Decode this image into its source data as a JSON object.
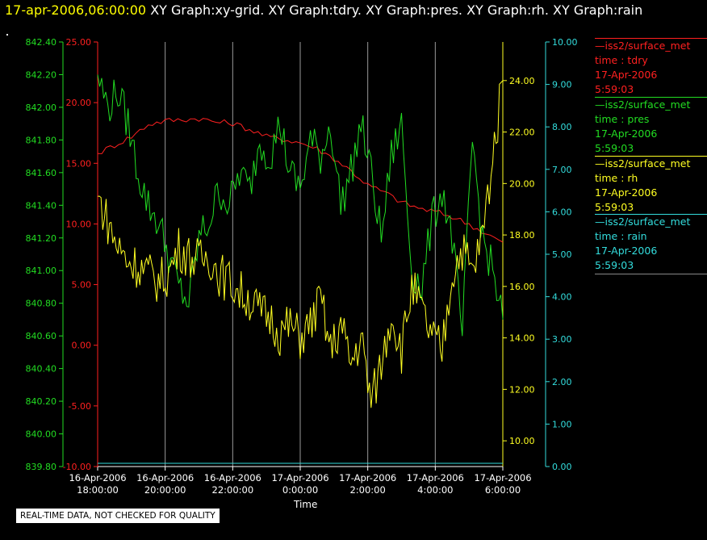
{
  "header": {
    "date": "17-apr-2006,06:00:00",
    "graphs": "XY Graph:xy-grid.  XY Graph:tdry.  XY Graph:pres.  XY Graph:rh.  XY Graph:rain"
  },
  "disclaimer": "REAL-TIME DATA, NOT CHECKED FOR QUALITY",
  "legend": [
    {
      "source": "—iss2/surface_met",
      "field": "time : tdry",
      "date": "17-Apr-2006",
      "time": "5:59:03",
      "color": "#ff2020"
    },
    {
      "source": "—iss2/surface_met",
      "field": "time : pres",
      "date": "17-Apr-2006",
      "time": "5:59:03",
      "color": "#22dd22"
    },
    {
      "source": "—iss2/surface_met",
      "field": "time : rh",
      "date": "17-Apr-2006",
      "time": "5:59:03",
      "color": "#ffff22"
    },
    {
      "source": "—iss2/surface_met",
      "field": "time : rain",
      "date": "17-Apr-2006",
      "time": "5:59:03",
      "color": "#33dddd"
    }
  ],
  "chart_data": {
    "type": "line",
    "xlabel": "Time",
    "x_ticks": [
      {
        "hour": 0,
        "line1": "16-Apr-2006",
        "line2": "18:00:00"
      },
      {
        "hour": 2,
        "line1": "16-Apr-2006",
        "line2": "20:00:00"
      },
      {
        "hour": 4,
        "line1": "16-Apr-2006",
        "line2": "22:00:00"
      },
      {
        "hour": 6,
        "line1": "17-Apr-2006",
        "line2": "0:00:00"
      },
      {
        "hour": 8,
        "line1": "17-Apr-2006",
        "line2": "2:00:00"
      },
      {
        "hour": 10,
        "line1": "17-Apr-2006",
        "line2": "4:00:00"
      },
      {
        "hour": 12,
        "line1": "17-Apr-2006",
        "line2": "6:00:00"
      }
    ],
    "xlim": [
      0,
      12
    ],
    "grid": true,
    "axes": [
      {
        "name": "pres",
        "color": "#22dd22",
        "ylim": [
          839.8,
          842.4
        ],
        "ticks": [
          "839.80",
          "840.00",
          "840.20",
          "840.40",
          "840.60",
          "840.80",
          "841.00",
          "841.20",
          "841.40",
          "841.60",
          "841.80",
          "842.00",
          "842.20",
          "842.40"
        ]
      },
      {
        "name": "tdry",
        "color": "#ff2020",
        "ylim": [
          -10,
          25
        ],
        "ticks": [
          "-10.00",
          "-5.00",
          "0.00",
          "5.00",
          "10.00",
          "15.00",
          "20.00",
          "25.00"
        ]
      },
      {
        "name": "rh",
        "color": "#ffff22",
        "ylim": [
          9,
          25.5
        ],
        "ticks": [
          "10.00",
          "12.00",
          "14.00",
          "16.00",
          "18.00",
          "20.00",
          "22.00",
          "24.00"
        ]
      },
      {
        "name": "rain",
        "color": "#33dddd",
        "ylim": [
          0,
          10
        ],
        "ticks": [
          "0.00",
          "1.00",
          "2.00",
          "3.00",
          "4.00",
          "5.00",
          "6.00",
          "7.00",
          "8.00",
          "9.00",
          "10.00"
        ]
      }
    ],
    "series": [
      {
        "name": "iss2/surface_met time : tdry",
        "axis": "tdry",
        "color": "#ff2020",
        "x": [
          0,
          0.5,
          1,
          1.5,
          2,
          2.5,
          3,
          3.5,
          4,
          4.5,
          5,
          5.5,
          6,
          6.5,
          7,
          7.5,
          8,
          8.5,
          9,
          9.5,
          10,
          10.5,
          11,
          11.5,
          12
        ],
        "y": [
          15.8,
          16.5,
          17.2,
          18.2,
          18.5,
          18.6,
          18.7,
          18.4,
          18.3,
          17.8,
          17.2,
          17.0,
          16.7,
          16.2,
          15.4,
          14.4,
          13.2,
          12.6,
          11.8,
          11.3,
          11.0,
          10.6,
          10.0,
          9.2,
          8.5
        ]
      },
      {
        "name": "iss2/surface_met time : pres",
        "axis": "pres",
        "color": "#22dd22",
        "x": [
          0,
          0.3,
          0.6,
          0.9,
          1.2,
          1.5,
          1.8,
          2.1,
          2.4,
          2.7,
          3.0,
          3.3,
          3.6,
          3.9,
          4.2,
          4.5,
          4.8,
          5.1,
          5.4,
          5.7,
          6.0,
          6.3,
          6.6,
          6.9,
          7.2,
          7.5,
          7.8,
          8.1,
          8.4,
          8.7,
          9.0,
          9.3,
          9.6,
          9.9,
          10.2,
          10.5,
          10.8,
          11.1,
          11.4,
          11.7,
          12
        ],
        "y": [
          842.2,
          842.0,
          842.1,
          841.9,
          841.6,
          841.4,
          841.3,
          841.1,
          840.9,
          840.8,
          841.2,
          841.3,
          841.5,
          841.4,
          841.6,
          841.5,
          841.8,
          841.7,
          841.9,
          841.6,
          841.5,
          841.8,
          841.7,
          841.9,
          841.4,
          841.6,
          841.9,
          841.6,
          841.2,
          841.7,
          841.9,
          841.0,
          840.9,
          841.3,
          841.5,
          841.2,
          840.6,
          841.8,
          841.2,
          841.0,
          840.7
        ]
      },
      {
        "name": "iss2/surface_met time : rh",
        "axis": "rh",
        "color": "#ffff22",
        "x": [
          0,
          0.3,
          0.6,
          0.9,
          1.2,
          1.5,
          1.8,
          2.1,
          2.4,
          2.7,
          3.0,
          3.3,
          3.6,
          3.9,
          4.2,
          4.5,
          4.8,
          5.1,
          5.4,
          5.7,
          6.0,
          6.3,
          6.6,
          6.9,
          7.2,
          7.5,
          7.8,
          8.1,
          8.4,
          8.7,
          9.0,
          9.3,
          9.6,
          9.9,
          10.2,
          10.5,
          10.8,
          11.1,
          11.4,
          11.7,
          12
        ],
        "y": [
          19.5,
          18.5,
          17.5,
          17.0,
          16.8,
          16.5,
          16.2,
          16.5,
          17.5,
          17.2,
          17.0,
          17.2,
          16.5,
          16.2,
          15.8,
          15.5,
          15.0,
          14.8,
          14.2,
          14.5,
          14.0,
          14.5,
          15.5,
          13.5,
          14.5,
          13.0,
          14.0,
          11.5,
          13.0,
          15.0,
          13.5,
          16.0,
          15.0,
          14.0,
          13.5,
          16.5,
          17.5,
          16.5,
          18.0,
          21.0,
          24.0
        ]
      },
      {
        "name": "iss2/surface_met time : rain",
        "axis": "rain",
        "color": "#33dddd",
        "x": [
          0,
          12
        ],
        "y": [
          0,
          0
        ]
      }
    ]
  }
}
